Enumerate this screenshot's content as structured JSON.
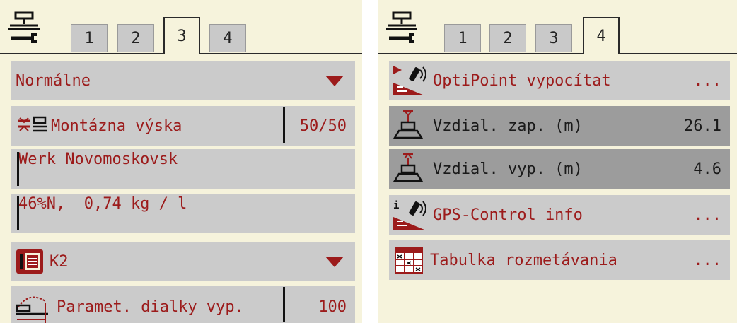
{
  "left": {
    "tabs": [
      "1",
      "2",
      "3",
      "4"
    ],
    "active_tab": "3",
    "rows": {
      "mode": "Normálne",
      "mount_label": "Montázna výska",
      "mount_value": "50/50",
      "fertilizer_maker": "Werk Novomoskovsk",
      "fertilizer_spec": "46%N,  0,74 kg / l",
      "disc_label": "K2",
      "param_label": "Paramet. dialky vyp.",
      "param_value": "100"
    }
  },
  "right": {
    "tabs": [
      "1",
      "2",
      "3",
      "4"
    ],
    "active_tab": "4",
    "rows": {
      "optipoint_label": "OptiPoint vypocítat",
      "optipoint_value": "...",
      "dist_on_label": "Vzdial. zap. (m)",
      "dist_on_value": "26.1",
      "dist_off_label": "Vzdial. vyp. (m)",
      "dist_off_value": "4.6",
      "gps_label": "GPS-Control info",
      "gps_value": "...",
      "table_label": "Tabulka rozmetávania",
      "table_value": "..."
    }
  },
  "colors": {
    "panel_bg": "#f6f3dc",
    "row_bg": "#cbcbcb",
    "row_selected_bg": "#9c9c9c",
    "text_red": "#9c1b1b"
  }
}
